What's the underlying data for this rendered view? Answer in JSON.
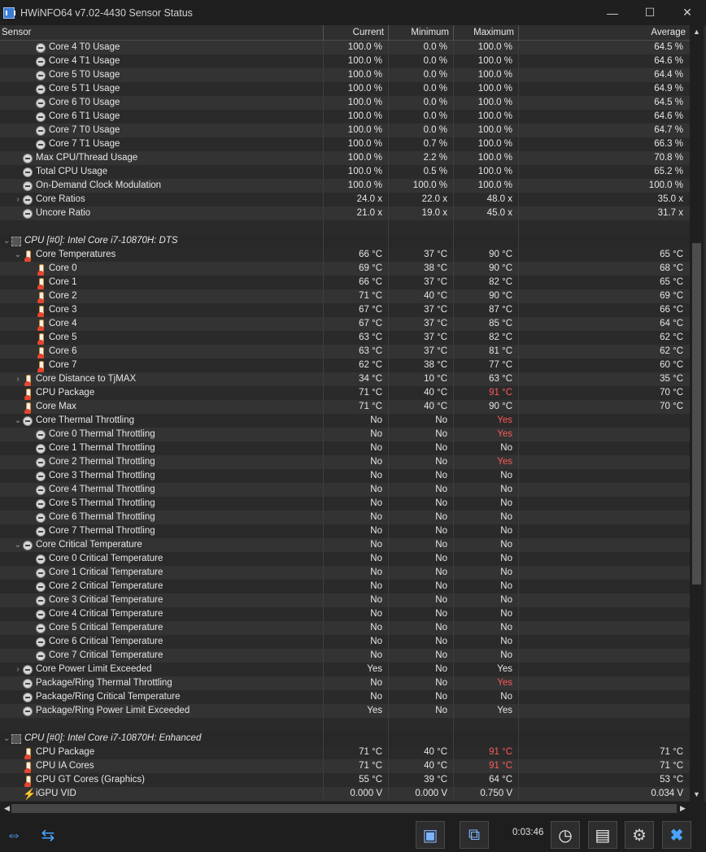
{
  "window": {
    "title": "HWiNFO64 v7.02-4430 Sensor Status",
    "minimize": "—",
    "maximize": "☐",
    "close": "✕"
  },
  "columns": {
    "sensor": "Sensor",
    "current": "Current",
    "minimum": "Minimum",
    "maximum": "Maximum",
    "average": "Average"
  },
  "rows": [
    {
      "name": "Core 4 T0 Usage",
      "indent": 2,
      "icon": "clock-icon",
      "cur": "100.0 %",
      "min": "0.0 %",
      "max": "100.0 %",
      "avg": "64.5 %"
    },
    {
      "name": "Core 4 T1 Usage",
      "indent": 2,
      "icon": "clock-icon",
      "cur": "100.0 %",
      "min": "0.0 %",
      "max": "100.0 %",
      "avg": "64.6 %"
    },
    {
      "name": "Core 5 T0 Usage",
      "indent": 2,
      "icon": "clock-icon",
      "cur": "100.0 %",
      "min": "0.0 %",
      "max": "100.0 %",
      "avg": "64.4 %"
    },
    {
      "name": "Core 5 T1 Usage",
      "indent": 2,
      "icon": "clock-icon",
      "cur": "100.0 %",
      "min": "0.0 %",
      "max": "100.0 %",
      "avg": "64.9 %"
    },
    {
      "name": "Core 6 T0 Usage",
      "indent": 2,
      "icon": "clock-icon",
      "cur": "100.0 %",
      "min": "0.0 %",
      "max": "100.0 %",
      "avg": "64.5 %"
    },
    {
      "name": "Core 6 T1 Usage",
      "indent": 2,
      "icon": "clock-icon",
      "cur": "100.0 %",
      "min": "0.0 %",
      "max": "100.0 %",
      "avg": "64.6 %"
    },
    {
      "name": "Core 7 T0 Usage",
      "indent": 2,
      "icon": "clock-icon",
      "cur": "100.0 %",
      "min": "0.0 %",
      "max": "100.0 %",
      "avg": "64.7 %"
    },
    {
      "name": "Core 7 T1 Usage",
      "indent": 2,
      "icon": "clock-icon",
      "cur": "100.0 %",
      "min": "0.7 %",
      "max": "100.0 %",
      "avg": "66.3 %"
    },
    {
      "name": "Max CPU/Thread Usage",
      "indent": 1,
      "icon": "clock-icon",
      "cur": "100.0 %",
      "min": "2.2 %",
      "max": "100.0 %",
      "avg": "70.8 %"
    },
    {
      "name": "Total CPU Usage",
      "indent": 1,
      "icon": "clock-icon",
      "cur": "100.0 %",
      "min": "0.5 %",
      "max": "100.0 %",
      "avg": "65.2 %"
    },
    {
      "name": "On-Demand Clock Modulation",
      "indent": 1,
      "icon": "clock-icon",
      "cur": "100.0 %",
      "min": "100.0 %",
      "max": "100.0 %",
      "avg": "100.0 %"
    },
    {
      "name": "Core Ratios",
      "indent": 1,
      "expander": "›",
      "icon": "clock-icon",
      "cur": "24.0 x",
      "min": "22.0 x",
      "max": "48.0 x",
      "avg": "35.0 x"
    },
    {
      "name": "Uncore Ratio",
      "indent": 1,
      "icon": "clock-icon",
      "cur": "21.0 x",
      "min": "19.0 x",
      "max": "45.0 x",
      "avg": "31.7 x"
    },
    {
      "name": "",
      "indent": 0,
      "blank": true
    },
    {
      "name": "CPU [#0]: Intel Core i7-10870H: DTS",
      "indent": 0,
      "expander": "⌄",
      "icon": "chip-icon",
      "group": true
    },
    {
      "name": "Core Temperatures",
      "indent": 1,
      "expander": "⌄",
      "icon": "thermometer-icon",
      "cur": "66 °C",
      "min": "37 °C",
      "max": "90 °C",
      "avg": "65 °C"
    },
    {
      "name": "Core 0",
      "indent": 2,
      "icon": "thermometer-icon",
      "cur": "69 °C",
      "min": "38 °C",
      "max": "90 °C",
      "avg": "68 °C"
    },
    {
      "name": "Core 1",
      "indent": 2,
      "icon": "thermometer-icon",
      "cur": "66 °C",
      "min": "37 °C",
      "max": "82 °C",
      "avg": "65 °C"
    },
    {
      "name": "Core 2",
      "indent": 2,
      "icon": "thermometer-icon",
      "cur": "71 °C",
      "min": "40 °C",
      "max": "90 °C",
      "avg": "69 °C"
    },
    {
      "name": "Core 3",
      "indent": 2,
      "icon": "thermometer-icon",
      "cur": "67 °C",
      "min": "37 °C",
      "max": "87 °C",
      "avg": "66 °C"
    },
    {
      "name": "Core 4",
      "indent": 2,
      "icon": "thermometer-icon",
      "cur": "67 °C",
      "min": "37 °C",
      "max": "85 °C",
      "avg": "64 °C"
    },
    {
      "name": "Core 5",
      "indent": 2,
      "icon": "thermometer-icon",
      "cur": "63 °C",
      "min": "37 °C",
      "max": "82 °C",
      "avg": "62 °C"
    },
    {
      "name": "Core 6",
      "indent": 2,
      "icon": "thermometer-icon",
      "cur": "63 °C",
      "min": "37 °C",
      "max": "81 °C",
      "avg": "62 °C"
    },
    {
      "name": "Core 7",
      "indent": 2,
      "icon": "thermometer-icon",
      "cur": "62 °C",
      "min": "38 °C",
      "max": "77 °C",
      "avg": "60 °C"
    },
    {
      "name": "Core Distance to TjMAX",
      "indent": 1,
      "expander": "›",
      "icon": "thermometer-icon",
      "cur": "34 °C",
      "min": "10 °C",
      "max": "63 °C",
      "avg": "35 °C"
    },
    {
      "name": "CPU Package",
      "indent": 1,
      "icon": "thermometer-icon",
      "cur": "71 °C",
      "min": "40 °C",
      "max": "91 °C",
      "avg": "70 °C",
      "max_red": true
    },
    {
      "name": "Core Max",
      "indent": 1,
      "icon": "thermometer-icon",
      "cur": "71 °C",
      "min": "40 °C",
      "max": "90 °C",
      "avg": "70 °C"
    },
    {
      "name": "Core Thermal Throttling",
      "indent": 1,
      "expander": "⌄",
      "icon": "clock-icon",
      "cur": "No",
      "min": "No",
      "max": "Yes",
      "avg": "",
      "max_red": true
    },
    {
      "name": "Core 0 Thermal Throttling",
      "indent": 2,
      "icon": "clock-icon",
      "cur": "No",
      "min": "No",
      "max": "Yes",
      "avg": "",
      "max_red": true
    },
    {
      "name": "Core 1 Thermal Throttling",
      "indent": 2,
      "icon": "clock-icon",
      "cur": "No",
      "min": "No",
      "max": "No",
      "avg": ""
    },
    {
      "name": "Core 2 Thermal Throttling",
      "indent": 2,
      "icon": "clock-icon",
      "cur": "No",
      "min": "No",
      "max": "Yes",
      "avg": "",
      "max_red": true
    },
    {
      "name": "Core 3 Thermal Throttling",
      "indent": 2,
      "icon": "clock-icon",
      "cur": "No",
      "min": "No",
      "max": "No",
      "avg": ""
    },
    {
      "name": "Core 4 Thermal Throttling",
      "indent": 2,
      "icon": "clock-icon",
      "cur": "No",
      "min": "No",
      "max": "No",
      "avg": ""
    },
    {
      "name": "Core 5 Thermal Throttling",
      "indent": 2,
      "icon": "clock-icon",
      "cur": "No",
      "min": "No",
      "max": "No",
      "avg": ""
    },
    {
      "name": "Core 6 Thermal Throttling",
      "indent": 2,
      "icon": "clock-icon",
      "cur": "No",
      "min": "No",
      "max": "No",
      "avg": ""
    },
    {
      "name": "Core 7 Thermal Throttling",
      "indent": 2,
      "icon": "clock-icon",
      "cur": "No",
      "min": "No",
      "max": "No",
      "avg": ""
    },
    {
      "name": "Core Critical Temperature",
      "indent": 1,
      "expander": "⌄",
      "icon": "clock-icon",
      "cur": "No",
      "min": "No",
      "max": "No",
      "avg": ""
    },
    {
      "name": "Core 0 Critical Temperature",
      "indent": 2,
      "icon": "clock-icon",
      "cur": "No",
      "min": "No",
      "max": "No",
      "avg": ""
    },
    {
      "name": "Core 1 Critical Temperature",
      "indent": 2,
      "icon": "clock-icon",
      "cur": "No",
      "min": "No",
      "max": "No",
      "avg": ""
    },
    {
      "name": "Core 2 Critical Temperature",
      "indent": 2,
      "icon": "clock-icon",
      "cur": "No",
      "min": "No",
      "max": "No",
      "avg": ""
    },
    {
      "name": "Core 3 Critical Temperature",
      "indent": 2,
      "icon": "clock-icon",
      "cur": "No",
      "min": "No",
      "max": "No",
      "avg": ""
    },
    {
      "name": "Core 4 Critical Temperature",
      "indent": 2,
      "icon": "clock-icon",
      "cur": "No",
      "min": "No",
      "max": "No",
      "avg": ""
    },
    {
      "name": "Core 5 Critical Temperature",
      "indent": 2,
      "icon": "clock-icon",
      "cur": "No",
      "min": "No",
      "max": "No",
      "avg": ""
    },
    {
      "name": "Core 6 Critical Temperature",
      "indent": 2,
      "icon": "clock-icon",
      "cur": "No",
      "min": "No",
      "max": "No",
      "avg": ""
    },
    {
      "name": "Core 7 Critical Temperature",
      "indent": 2,
      "icon": "clock-icon",
      "cur": "No",
      "min": "No",
      "max": "No",
      "avg": ""
    },
    {
      "name": "Core Power Limit Exceeded",
      "indent": 1,
      "expander": "›",
      "icon": "clock-icon",
      "cur": "Yes",
      "min": "No",
      "max": "Yes",
      "avg": ""
    },
    {
      "name": "Package/Ring Thermal Throttling",
      "indent": 1,
      "icon": "clock-icon",
      "cur": "No",
      "min": "No",
      "max": "Yes",
      "avg": "",
      "max_red": true
    },
    {
      "name": "Package/Ring Critical Temperature",
      "indent": 1,
      "icon": "clock-icon",
      "cur": "No",
      "min": "No",
      "max": "No",
      "avg": ""
    },
    {
      "name": "Package/Ring Power Limit Exceeded",
      "indent": 1,
      "icon": "clock-icon",
      "cur": "Yes",
      "min": "No",
      "max": "Yes",
      "avg": ""
    },
    {
      "name": "",
      "indent": 0,
      "blank": true
    },
    {
      "name": "CPU [#0]: Intel Core i7-10870H: Enhanced",
      "indent": 0,
      "expander": "⌄",
      "icon": "chip-icon",
      "group": true
    },
    {
      "name": "CPU Package",
      "indent": 1,
      "icon": "thermometer-icon",
      "cur": "71 °C",
      "min": "40 °C",
      "max": "91 °C",
      "avg": "71 °C",
      "max_red": true
    },
    {
      "name": "CPU IA Cores",
      "indent": 1,
      "icon": "thermometer-icon",
      "cur": "71 °C",
      "min": "40 °C",
      "max": "91 °C",
      "avg": "71 °C",
      "max_red": true
    },
    {
      "name": "CPU GT Cores (Graphics)",
      "indent": 1,
      "icon": "thermometer-icon",
      "cur": "55 °C",
      "min": "39 °C",
      "max": "64 °C",
      "avg": "53 °C"
    },
    {
      "name": "iGPU VID",
      "indent": 1,
      "icon": "bolt-icon",
      "cur": "0.000 V",
      "min": "0.000 V",
      "max": "0.750 V",
      "avg": "0.034 V"
    }
  ],
  "footer": {
    "timer": "0:03:46"
  },
  "colors": {
    "alert": "#ff5a5a",
    "background": "#2b2b2b"
  }
}
